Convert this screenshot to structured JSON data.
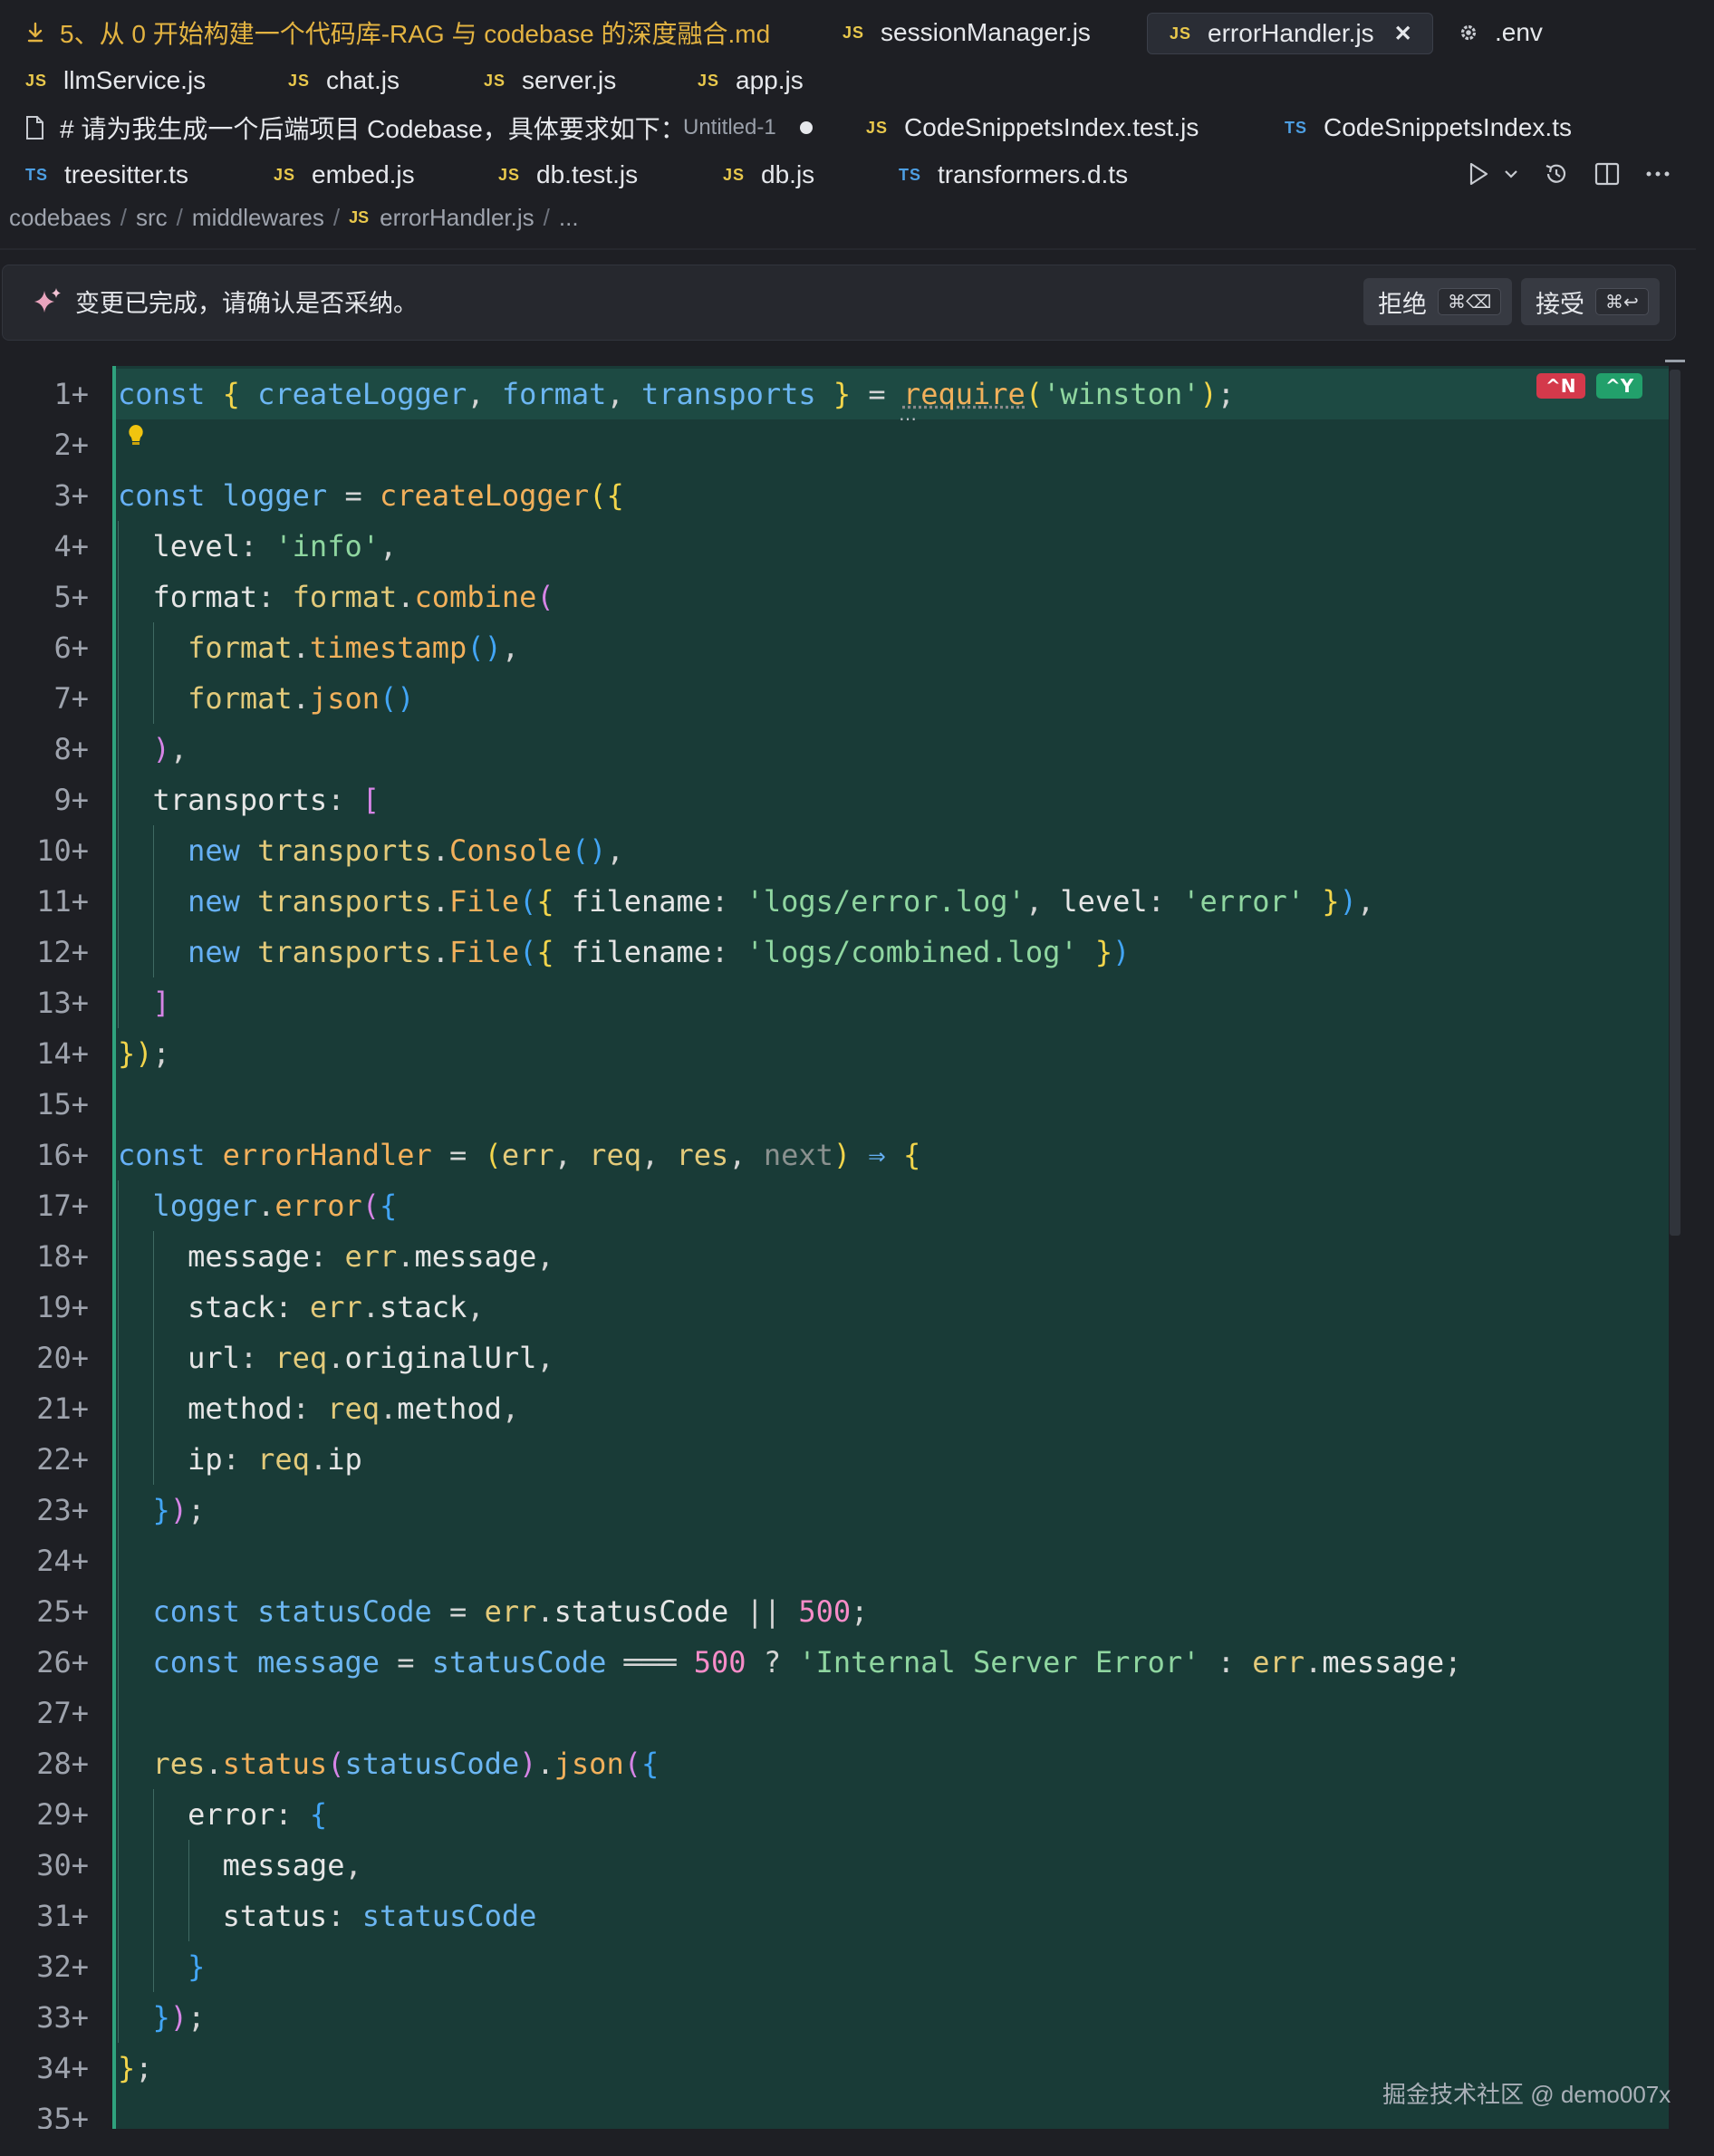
{
  "tabs": {
    "row1": [
      {
        "label": "5、从 0 开始构建一个代码库-RAG 与 codebase 的深度融合.md",
        "icon": "markdown-preview-icon",
        "modified": true
      },
      {
        "label": "sessionManager.js",
        "type": "JS"
      },
      {
        "label": "errorHandler.js",
        "type": "JS",
        "active": true,
        "close": "✕"
      },
      {
        "label": ".env",
        "icon": "gear-icon"
      }
    ],
    "row2": [
      {
        "label": "llmService.js",
        "type": "JS"
      },
      {
        "label": "chat.js",
        "type": "JS"
      },
      {
        "label": "server.js",
        "type": "JS"
      },
      {
        "label": "app.js",
        "type": "JS"
      }
    ],
    "row3": [
      {
        "label": "# 请为我生成一个后端项目 Codebase，具体要求如下：",
        "icon": "file-icon"
      },
      {
        "label": "Untitled-1",
        "dirty": true
      },
      {
        "label": "CodeSnippetsIndex.test.js",
        "type": "JS"
      },
      {
        "label": "CodeSnippetsIndex.ts",
        "type": "TS"
      }
    ],
    "row4": [
      {
        "label": "treesitter.ts",
        "type": "TS"
      },
      {
        "label": "embed.js",
        "type": "JS"
      },
      {
        "label": "db.test.js",
        "type": "JS"
      },
      {
        "label": "db.js",
        "type": "JS"
      },
      {
        "label": "transformers.d.ts",
        "type": "TS"
      }
    ]
  },
  "toolbar": {
    "icons": [
      "run-icon",
      "chevron-down-icon",
      "history-icon",
      "split-editor-icon",
      "more-icon"
    ]
  },
  "breadcrumb": {
    "items": [
      "codebaes",
      "src",
      "middlewares",
      "errorHandler.js",
      "..."
    ],
    "file_type": "JS"
  },
  "banner": {
    "message": "变更已完成，请确认是否采纳。",
    "reject_label": "拒绝",
    "reject_shortcut": "⌘⌫",
    "accept_label": "接受",
    "accept_shortcut": "⌘↩"
  },
  "editor": {
    "file": "errorHandler.js",
    "line_suffix": "+",
    "first_line": 1,
    "last_line": 35,
    "badges": {
      "reject": "^N",
      "accept": "^Y"
    },
    "colors": {
      "diff_background": "#193b37",
      "reject_badge": "#d4394b",
      "accept_badge": "#22a06b"
    }
  },
  "watermark": "掘金技术社区 @ demo007x"
}
